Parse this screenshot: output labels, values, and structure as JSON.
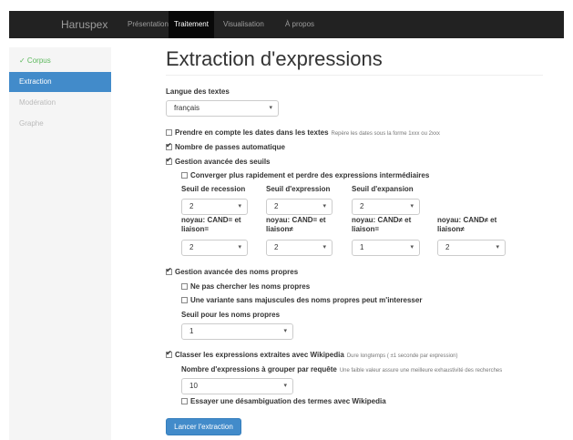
{
  "navbar": {
    "brand": "Haruspex",
    "items": [
      "Présentation",
      "Traitement",
      "Visualisation",
      "À propos"
    ]
  },
  "sidebar": {
    "items": [
      "✓ Corpus",
      "Extraction",
      "Modération",
      "Graphe"
    ]
  },
  "title": "Extraction d'expressions",
  "langue": {
    "label": "Langue des textes",
    "value": "français"
  },
  "dates": {
    "label": "Prendre en compte les dates dans les textes",
    "help": "Repère les dates sous la forme 1xxx ou 2xxx"
  },
  "passes": {
    "label": "Nombre de passes automatique"
  },
  "seuils": {
    "label": "Gestion avancée des seuils",
    "converger": "Converger plus rapidement et perdre des expressions intermédiaires",
    "recession": {
      "label": "Seuil de recession",
      "value": "2"
    },
    "expression": {
      "label": "Seuil d'expression",
      "value": "2"
    },
    "expansion": {
      "label": "Seuil d'expansion",
      "value": "2"
    },
    "noyau1": {
      "label": "noyau: CAND= et liaison=",
      "value": "2"
    },
    "noyau2": {
      "label": "noyau: CAND= et liaison≠",
      "value": "2"
    },
    "noyau3": {
      "label": "noyau: CAND≠ et liaison=",
      "value": "1"
    },
    "noyau4": {
      "label": "noyau: CAND≠ et liaison≠",
      "value": "2"
    }
  },
  "noms": {
    "label": "Gestion avancée des noms propres",
    "pas_chercher": "Ne pas chercher les noms propres",
    "variante": "Une variante sans majuscules des noms propres peut m'interesser",
    "seuil": {
      "label": "Seuil pour les noms propres",
      "value": "1"
    }
  },
  "wiki": {
    "label": "Classer les expressions extraites avec Wikipedia",
    "help": "Dure longtemps ( ±1 seconde par expression)",
    "grouper": {
      "label": "Nombre d'expressions à grouper par requête",
      "help": "Une faible valeur assure une meilleure exhaustivité des recherches",
      "value": "10"
    },
    "desamb": "Essayer une désambiguation des termes avec Wikipedia"
  },
  "submit": "Lancer l'extraction"
}
